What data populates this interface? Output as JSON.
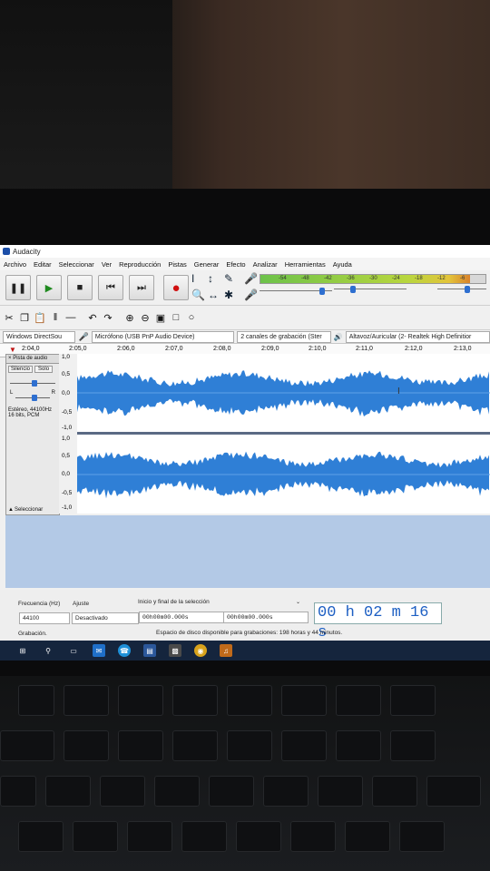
{
  "window": {
    "title": "Audacity"
  },
  "menu": [
    "Archivo",
    "Editar",
    "Seleccionar",
    "Ver",
    "Reproducción",
    "Pistas",
    "Generar",
    "Efecto",
    "Analizar",
    "Herramientas",
    "Ayuda"
  ],
  "meters": {
    "scale": [
      "-54",
      "-48",
      "-42",
      "-36",
      "-30",
      "-24",
      "-18",
      "-12",
      "-6"
    ],
    "record_level_fraction": 0.93
  },
  "devices": {
    "host": "Windows DirectSou",
    "input": "Micrófono (USB PnP Audio Device)",
    "channels": "2 canales de grabación (Ster",
    "output": "Altavoz/Auricular (2- Realtek High Definitior"
  },
  "timeline": [
    "2:04,0",
    "2:05,0",
    "2:06,0",
    "2:07,0",
    "2:08,0",
    "2:09,0",
    "2:10,0",
    "2:11,0",
    "2:12,0",
    "2:13,0"
  ],
  "track": {
    "name": "Pista de audio",
    "mute": "Silencio",
    "solo": "Solo",
    "pan_left": "L",
    "pan_right": "R",
    "info": "Estéreo, 44100Hz",
    "format": "16 bits, PCM",
    "select": "Seleccionar",
    "scale_top": [
      "1,0",
      "0,5",
      "0,0",
      "-0,5",
      "-1,0"
    ],
    "scale_bottom": [
      "1,0",
      "0,5",
      "0,0",
      "-0,5",
      "-1,0"
    ]
  },
  "bottom": {
    "rate_label": "Frecuencia (Hz)",
    "snap_label": "Ajuste",
    "rate_value": "44100",
    "snap_value": "Desactivado",
    "selection_label": "Inicio y final de la selección",
    "sel_start": "00h00m00.000s",
    "sel_end": "00h00m00.000s",
    "time": "00 h 02 m 16 s",
    "status_left": "Grabación.",
    "status_right": "Espacio de disco disponible para grabaciones: 198 horas y 44 minutos."
  }
}
